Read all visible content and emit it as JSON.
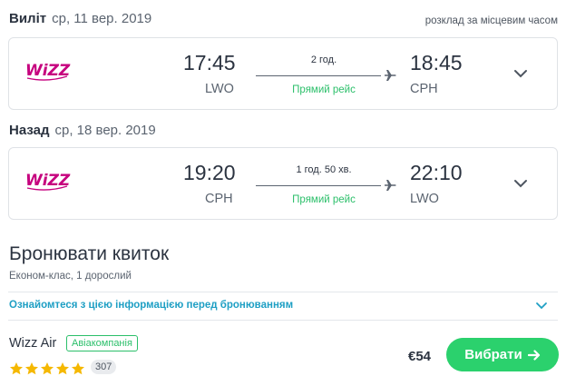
{
  "outbound": {
    "label": "Виліт",
    "date": "ср, 11 вер. 2019",
    "local_time_note": "розклад за місцевим часом",
    "airline_logo": "wizz-logo",
    "departure_time": "17:45",
    "departure_code": "LWO",
    "duration": "2 год.",
    "stops": "Прямий рейс",
    "arrival_time": "18:45",
    "arrival_code": "CPH"
  },
  "return": {
    "label": "Назад",
    "date": "ср, 18 вер. 2019",
    "airline_logo": "wizz-logo",
    "departure_time": "19:20",
    "departure_code": "CPH",
    "duration": "1 год. 50 хв.",
    "stops": "Прямий рейс",
    "arrival_time": "22:10",
    "arrival_code": "LWO"
  },
  "booking": {
    "title": "Бронювати квиток",
    "subtitle": "Економ-клас, 1 дорослий",
    "info_link": "Ознайомтеся з цією інформацією перед бронюванням",
    "airline_name": "Wizz Air",
    "airline_badge": "Авіакомпанія",
    "stars": 5,
    "reviews_count": "307",
    "price": "€54",
    "select_label": "Вибрати"
  },
  "colors": {
    "accent_green": "#2bd16d",
    "link_blue": "#1e9fc4",
    "star_gold": "#f5b800",
    "wizz_purple": "#c6007e"
  }
}
